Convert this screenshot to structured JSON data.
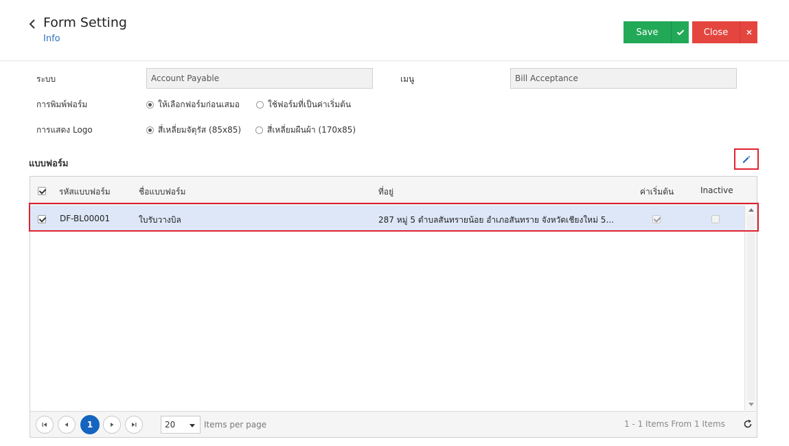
{
  "header": {
    "title": "Form Setting",
    "subtitle": "Info",
    "save_label": "Save",
    "close_label": "Close"
  },
  "form": {
    "system_label": "ระบบ",
    "system_value": "Account Payable",
    "menu_label": "เมนู",
    "menu_value": "Bill Acceptance",
    "print_label": "การพิมพ์ฟอร์ม",
    "print_options": [
      {
        "label": "ให้เลือกฟอร์มก่อนเสมอ",
        "selected": true
      },
      {
        "label": "ใช้ฟอร์มที่เป็นค่าเริ่มต้น",
        "selected": false
      }
    ],
    "logo_label": "การแสดง Logo",
    "logo_options": [
      {
        "label": "สี่เหลี่ยมจัตุรัส (85x85)",
        "selected": true
      },
      {
        "label": "สี่เหลี่ยมผืนผ้า (170x85)",
        "selected": false
      }
    ]
  },
  "section": {
    "title": "แบบฟอร์ม",
    "edit_icon": "pencil-icon"
  },
  "grid": {
    "columns": [
      "รหัสแบบฟอร์ม",
      "ชื่อแบบฟอร์ม",
      "ที่อยู่",
      "ค่าเริ่มต้น",
      "Inactive"
    ],
    "rows": [
      {
        "checked": true,
        "code": "DF-BL00001",
        "name": "ใบรับวางบิล",
        "address": "287 หมู่ 5 ตำบลสันทรายน้อย อำเภอสันทราย จังหวัดเชียงใหม่ 5...",
        "default": true,
        "inactive": false
      }
    ]
  },
  "pager": {
    "current_page": "1",
    "page_size": "20",
    "items_per_page_label": "Items per page",
    "info": "1 - 1 Items From 1 Items"
  },
  "colors": {
    "save": "#22a958",
    "close": "#e4463f",
    "accent": "#1565c0",
    "highlight": "#e02030",
    "selected_row": "#dde7f7"
  }
}
